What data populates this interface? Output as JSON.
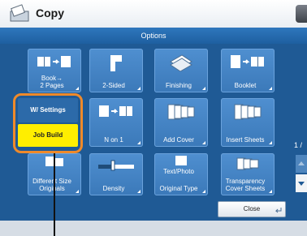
{
  "window": {
    "title": "Copy"
  },
  "header": {
    "title": "Options"
  },
  "tiles": [
    {
      "label": "Book→\n2 Pages"
    },
    {
      "label": "2-Sided"
    },
    {
      "label": "Finishing"
    },
    {
      "label": "Booklet"
    },
    {
      "label": "N on 1"
    },
    {
      "label": "Add Cover"
    },
    {
      "label": "Insert Sheets"
    },
    {
      "label": "Different Size\nOriginals"
    },
    {
      "label": "Density"
    },
    {
      "label": "Original Type"
    },
    {
      "label": "Transparency\nCover Sheets"
    }
  ],
  "text_photo": "Text/Photo",
  "job_build": {
    "top": "W/ Settings",
    "bottom": "Job Build"
  },
  "pager": "1 /",
  "close_label": "Close"
}
